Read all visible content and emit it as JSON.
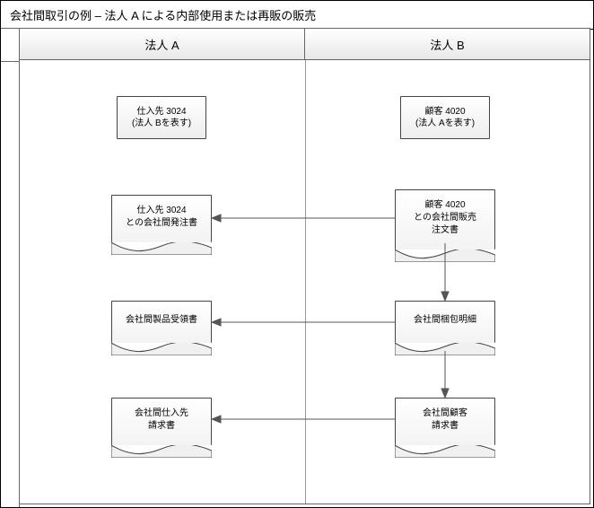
{
  "title": "会社間取引の例 – 法人 A による内部使用または再販の販売",
  "columns": {
    "a": "法人 A",
    "b": "法人 B"
  },
  "boxes": {
    "supplier3024": {
      "line1": "仕入先 3024",
      "line2": "(法人 Bを表す)"
    },
    "customer4020": {
      "line1": "顧客 4020",
      "line2": "(法人 Aを表す)"
    }
  },
  "docs": {
    "po": {
      "line1": "仕入先 3024",
      "line2": "との会社間発注書"
    },
    "so": {
      "line1": "顧客 4020",
      "line2": "との会社間販売",
      "line3": "注文書"
    },
    "receipt": {
      "line1": "会社間製品受領書"
    },
    "packing": {
      "line1": "会社間梱包明細"
    },
    "vendinv": {
      "line1": "会社間仕入先",
      "line2": "請求書"
    },
    "custinv": {
      "line1": "会社間顧客",
      "line2": "請求書"
    }
  }
}
